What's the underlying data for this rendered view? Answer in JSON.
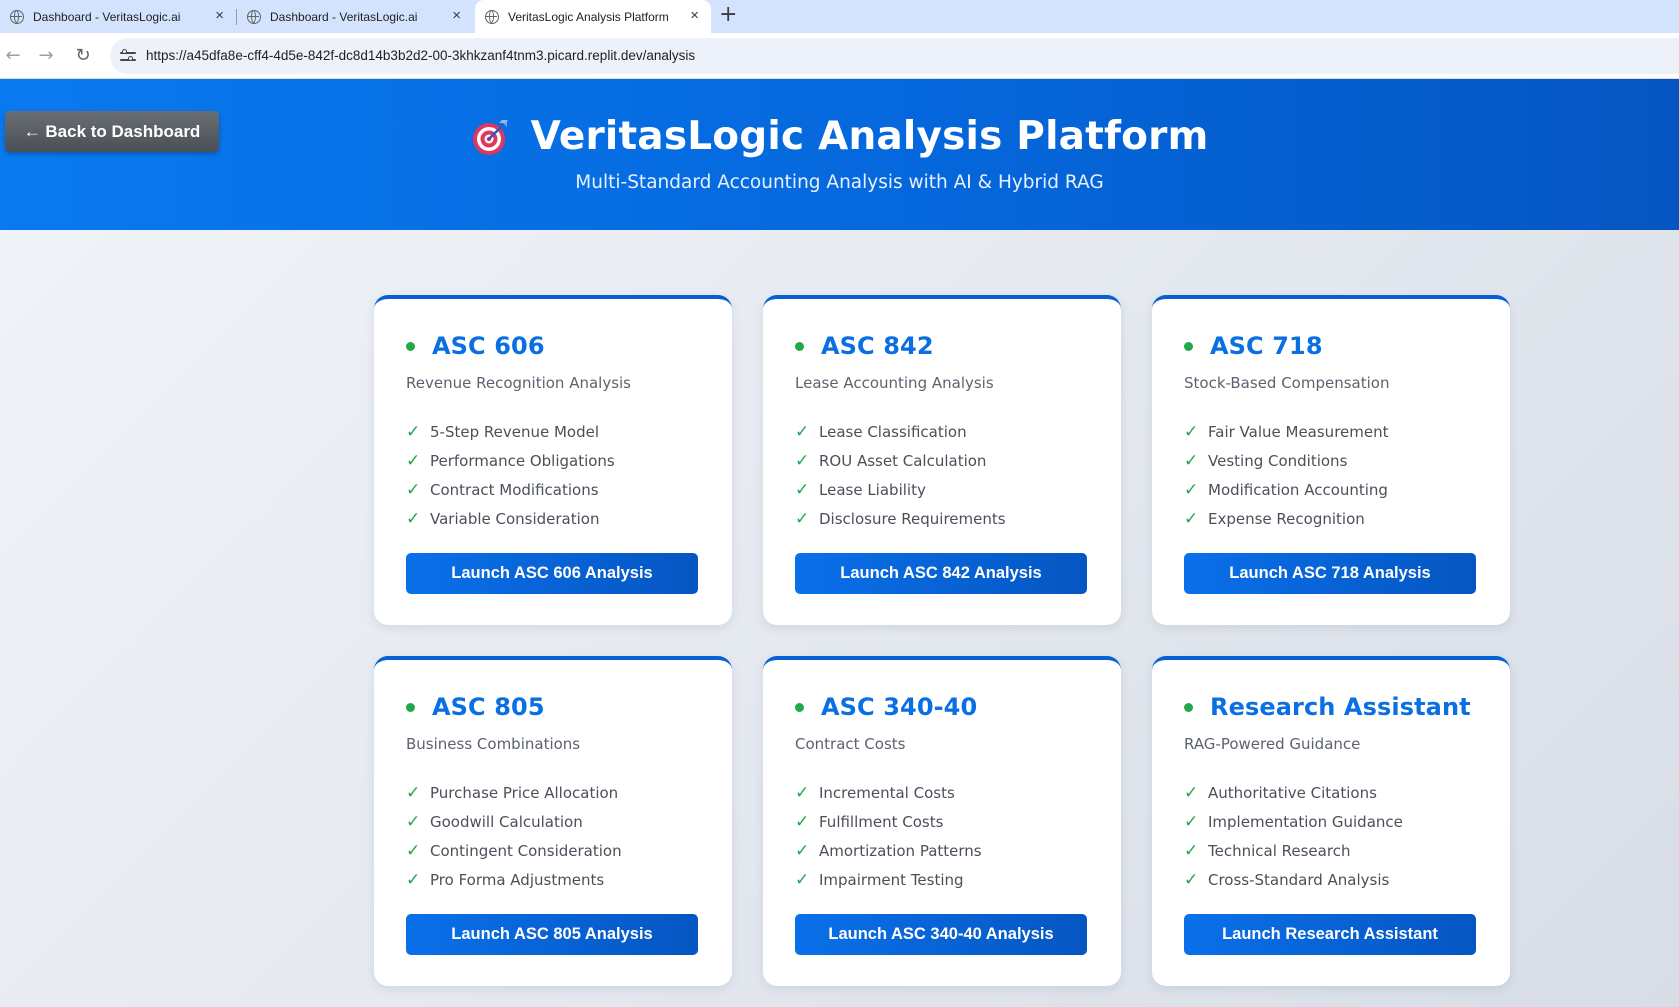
{
  "browser": {
    "tabs": [
      {
        "title": "Dashboard - VeritasLogic.ai",
        "active": false
      },
      {
        "title": "Dashboard - VeritasLogic.ai",
        "active": false
      },
      {
        "title": "VeritasLogic Analysis Platform",
        "active": true
      }
    ],
    "tab_close_glyph": "×",
    "new_tab_glyph": "+",
    "back_glyph": "←",
    "forward_glyph": "→",
    "reload_glyph": "↻",
    "url": "https://a45dfa8e-cff4-4d5e-842f-dc8d14b3b2d2-00-3khkzanf4tnm3.picard.replit.dev/analysis"
  },
  "header": {
    "back_button": "← Back to Dashboard",
    "title": "VeritasLogic Analysis Platform",
    "subtitle": "Multi-Standard Accounting Analysis with AI & Hybrid RAG",
    "icon": "target-icon"
  },
  "check_glyph": "✓",
  "colors": {
    "accent": "#0a6fe3",
    "status_green": "#20a84b",
    "header_blue": "#0567dc"
  },
  "cards": [
    {
      "title": "ASC 606",
      "subtitle": "Revenue Recognition Analysis",
      "features": [
        "5-Step Revenue Model",
        "Performance Obligations",
        "Contract Modifications",
        "Variable Consideration"
      ],
      "button": "Launch ASC 606 Analysis"
    },
    {
      "title": "ASC 842",
      "subtitle": "Lease Accounting Analysis",
      "features": [
        "Lease Classification",
        "ROU Asset Calculation",
        "Lease Liability",
        "Disclosure Requirements"
      ],
      "button": "Launch ASC 842 Analysis"
    },
    {
      "title": "ASC 718",
      "subtitle": "Stock-Based Compensation",
      "features": [
        "Fair Value Measurement",
        "Vesting Conditions",
        "Modification Accounting",
        "Expense Recognition"
      ],
      "button": "Launch ASC 718 Analysis"
    },
    {
      "title": "ASC 805",
      "subtitle": "Business Combinations",
      "features": [
        "Purchase Price Allocation",
        "Goodwill Calculation",
        "Contingent Consideration",
        "Pro Forma Adjustments"
      ],
      "button": "Launch ASC 805 Analysis"
    },
    {
      "title": "ASC 340-40",
      "subtitle": "Contract Costs",
      "features": [
        "Incremental Costs",
        "Fulfillment Costs",
        "Amortization Patterns",
        "Impairment Testing"
      ],
      "button": "Launch ASC 340-40 Analysis"
    },
    {
      "title": "Research Assistant",
      "subtitle": "RAG-Powered Guidance",
      "features": [
        "Authoritative Citations",
        "Implementation Guidance",
        "Technical Research",
        "Cross-Standard Analysis"
      ],
      "button": "Launch Research Assistant"
    }
  ]
}
